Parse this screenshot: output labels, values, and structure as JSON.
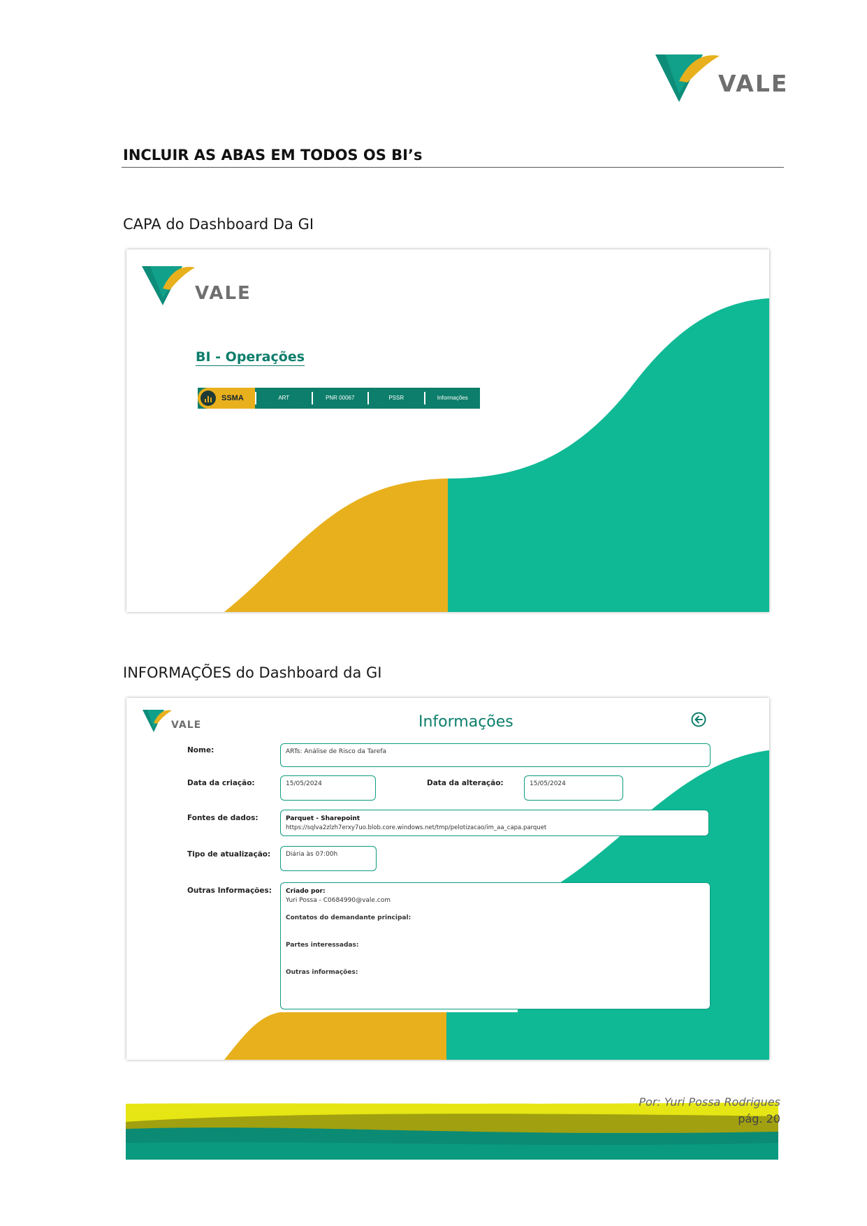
{
  "header_logo": {
    "brand": "VALE"
  },
  "doc_heading": "INCLUIR AS ABAS EM TODOS OS BI’s",
  "section1": {
    "label": "CAPA do Dashboard Da GI",
    "cover": {
      "logo": "VALE",
      "title": "BI - Operações",
      "tabs": [
        "SSMA",
        "ART",
        "PNR 00067",
        "PSSR",
        "Informações"
      ]
    }
  },
  "section2": {
    "label": "INFORMAÇÕES do Dashboard da GI",
    "info": {
      "logo": "VALE",
      "title": "Informações",
      "back_icon": "arrow-left-circle-icon",
      "nome_label": "Nome:",
      "nome_value": "ARTs: Análise de Risco da Tarefa",
      "data_criacao_label": "Data da criação:",
      "data_criacao_value": "15/05/2024",
      "data_alteracao_label": "Data da alteração:",
      "data_alteracao_value": "15/05/2024",
      "fontes_label": "Fontes de dados:",
      "fontes_title": "Parquet - Sharepoint",
      "fontes_url": "https://sqlva2zlzh7erxy7uo.blob.core.windows.net/tmp/pelotizacao/im_aa_capa.parquet",
      "tipo_label": "Tipo de atualização:",
      "tipo_value": "Diária às 07:00h",
      "outras_label": "Outras Informações:",
      "criado_por_label": "Criado por:",
      "criado_por_value": "Yuri Possa - C0684990@vale.com",
      "contatos_label": "Contatos do demandante principal:",
      "partes_label": "Partes interessadas:",
      "outras_info_label": "Outras informações:"
    }
  },
  "footer": {
    "author": "Por: Yuri Possa Rodrigues",
    "page": "pág. 20"
  },
  "colors": {
    "teal": "#0fb995",
    "dark_teal": "#0d7e6b",
    "gold": "#e8b01c",
    "footer_yellow": "#e6e614",
    "footer_olive": "#a0a010",
    "footer_teal": "#0b8a74"
  }
}
